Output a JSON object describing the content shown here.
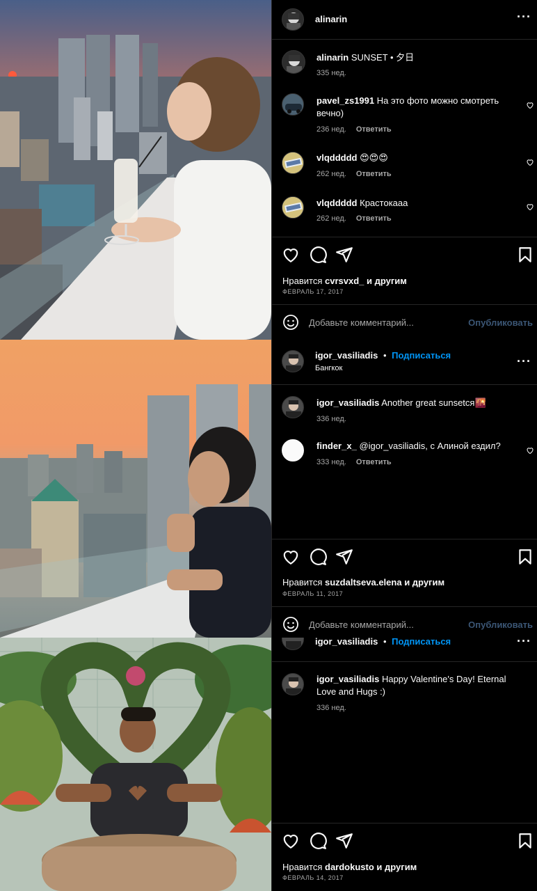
{
  "post1": {
    "header_user": "alinarin",
    "caption_user": "alinarin",
    "caption_text": "SUNSET • 夕日",
    "caption_age": "335 нед.",
    "comments": [
      {
        "user": "pavel_zs1991",
        "text": "На это фото можно смотреть вечно)",
        "age": "236 нед.",
        "reply": "Ответить"
      },
      {
        "user": "vlqddddd",
        "text": "😍😍😍",
        "age": "262 нед.",
        "reply": "Ответить"
      },
      {
        "user": "vlqddddd",
        "text": "Крастокааа",
        "age": "262 нед.",
        "reply": "Ответить"
      }
    ],
    "likes_prefix": "Нравится",
    "likes_user": "cvrsvxd_",
    "likes_suffix": "и другим",
    "date": "ФЕВРАЛЬ 17, 2017",
    "comment_placeholder": "Добавьте комментарий...",
    "publish": "Опубликовать"
  },
  "post2": {
    "header_user": "igor_vasiliadis",
    "follow": "Подписаться",
    "location": "Бангкок",
    "comments": [
      {
        "user": "igor_vasiliadis",
        "text": "Another great sunsetся🌇",
        "age": "336 нед.",
        "reply": ""
      },
      {
        "user": "finder_x_",
        "text": "@igor_vasiliadis, с Алиной ездил?",
        "age": "333 нед.",
        "reply": "Ответить"
      }
    ],
    "likes_prefix": "Нравится",
    "likes_user": "suzdaltseva.elena",
    "likes_suffix": "и другим",
    "date": "ФЕВРАЛЬ 11, 2017",
    "comment_placeholder": "Добавьте комментарий...",
    "publish": "Опубликовать"
  },
  "post3": {
    "header_user": "igor_vasiliadis",
    "follow": "Подписаться",
    "caption_user": "igor_vasiliadis",
    "caption_text": "Happy Valentine's Day! Eternal Love and Hugs :)",
    "caption_age": "336 нед.",
    "likes_prefix": "Нравится",
    "likes_user": "dardokusto",
    "likes_suffix": "и другим",
    "date": "ФЕВРАЛЬ 14, 2017"
  }
}
